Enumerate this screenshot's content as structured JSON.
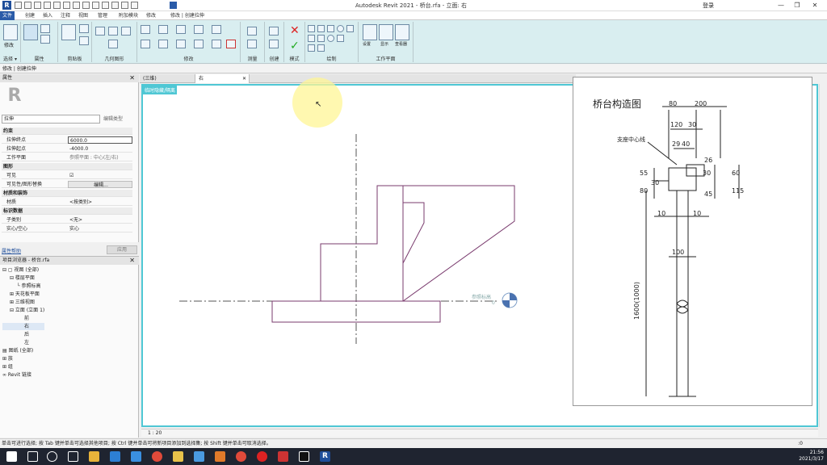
{
  "app": {
    "title": "Autodesk Revit 2021 - 桥台.rfa - 立面: 右",
    "signin": "登录"
  },
  "menu": {
    "items": [
      "文件",
      "创建",
      "插入",
      "注释",
      "视图",
      "管理",
      "附加模块",
      "修改",
      "修改 | 创建拉伸"
    ]
  },
  "ribbon": {
    "groups": [
      "选择 ▾",
      "属性",
      "剪贴板",
      "几何图形",
      "修改",
      "测量",
      "创建",
      "模式",
      "绘制",
      "工作平面"
    ],
    "modify_label": "修改",
    "wp_buttons": [
      "设置",
      "显示",
      "查看器"
    ]
  },
  "optionsbar": {
    "text": "修改 | 创建拉伸"
  },
  "properties": {
    "title": "属性",
    "type_name": "拉伸",
    "edit_type": "编辑类型",
    "rows": [
      {
        "cat": true,
        "label": "约束"
      },
      {
        "label": "拉伸终点",
        "value": "6000.0",
        "style": "box"
      },
      {
        "label": "拉伸起点",
        "value": "-4000.0",
        "style": ""
      },
      {
        "label": "工作平面",
        "value": "参照平面 : 中心(左/右)",
        "style": "grey"
      },
      {
        "cat": true,
        "label": "图形"
      },
      {
        "label": "可见",
        "value": "☑",
        "style": ""
      },
      {
        "label": "可见性/图形替换",
        "value": "编辑...",
        "style": "btn"
      },
      {
        "cat": true,
        "label": "材质和装饰"
      },
      {
        "label": "材质",
        "value": "<按类别>",
        "style": ""
      },
      {
        "cat": true,
        "label": "标识数据"
      },
      {
        "label": "子类别",
        "value": "<无>",
        "style": ""
      },
      {
        "label": "实心/空心",
        "value": "实心",
        "style": ""
      }
    ],
    "help": "属性帮助",
    "apply": "应用"
  },
  "browser": {
    "title": "项目浏览器 - 桥台.rfa",
    "items": [
      {
        "text": "⊟ ▢ 视图 (全部)",
        "indent": 0
      },
      {
        "text": "⊟ 楼层平面",
        "indent": 1
      },
      {
        "text": "└ 参照标高",
        "indent": 2
      },
      {
        "text": "⊞ 天花板平面",
        "indent": 1
      },
      {
        "text": "⊞ 三维视图",
        "indent": 1
      },
      {
        "text": "⊟ 立面 (立面 1)",
        "indent": 1
      },
      {
        "text": "前",
        "indent": 3
      },
      {
        "text": "右",
        "indent": 3,
        "sel": true
      },
      {
        "text": "后",
        "indent": 3
      },
      {
        "text": "左",
        "indent": 3
      },
      {
        "text": "▤ 图纸 (全部)",
        "indent": 0
      },
      {
        "text": "⊞ 族",
        "indent": 0
      },
      {
        "text": "⊞ 组",
        "indent": 0
      },
      {
        "text": "∞ Revit 链接",
        "indent": 0
      }
    ]
  },
  "tabs": [
    {
      "label": "(三维)",
      "active": false
    },
    {
      "label": "右",
      "active": true
    }
  ],
  "view": {
    "label": "临时隐藏/隔离",
    "ref_level": "参照标高",
    "ref_level_value": "0",
    "scale": "1 : 20"
  },
  "drawing": {
    "title": "桥台构造图",
    "support_line": "支座中心线",
    "dims": [
      "80",
      "200",
      "120",
      "30",
      "29",
      "40",
      "26",
      "30",
      "55",
      "60",
      "80",
      "30",
      "45",
      "115",
      "10",
      "10",
      "100",
      "1600(1000)"
    ]
  },
  "status": {
    "text": "单击可进行选择; 按 Tab 键并单击可选择其他项目; 按 Ctrl 键并单击可将新项目添加到选择集; 按 Shift 键并单击可取消选择。",
    "right": ":0"
  },
  "clock": {
    "time": "21:56",
    "date": "2021/3/17"
  }
}
